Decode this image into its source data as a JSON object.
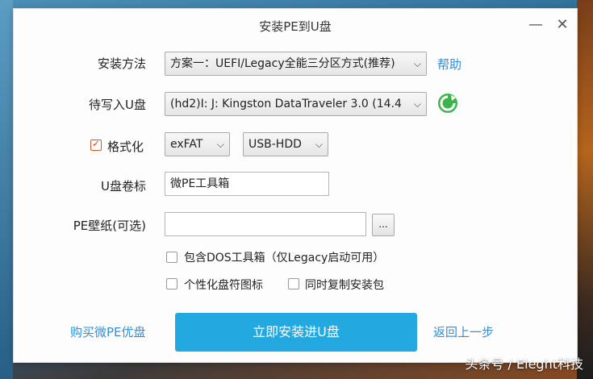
{
  "window": {
    "title": "安装PE到U盘",
    "minimize_glyph": "—",
    "close_glyph": "✕"
  },
  "install_method": {
    "label": "安装方法",
    "selected": "方案一：UEFI/Legacy全能三分区方式(推荐)",
    "help_link": "帮助"
  },
  "target_drive": {
    "label": "待写入U盘",
    "selected": "(hd2)I: J: Kingston DataTraveler 3.0 (14.4"
  },
  "format": {
    "label": "格式化",
    "checked": true,
    "filesystem": "exFAT",
    "mode": "USB-HDD"
  },
  "volume_label": {
    "label": "U盘卷标",
    "value": "微PE工具箱"
  },
  "wallpaper": {
    "label": "PE壁纸(可选)",
    "value": "",
    "browse_label": "..."
  },
  "options": {
    "dos_tools": "包含DOS工具箱（仅Legacy启动可用）",
    "custom_icon": "个性化盘符图标",
    "copy_installer": "同时复制安装包"
  },
  "footer": {
    "buy_link": "购买微PE优盘",
    "install_button": "立即安装进U盘",
    "back_link": "返回上一步"
  },
  "watermark": "头条号 / Eleght科技",
  "colors": {
    "accent": "#23a8e0",
    "link": "#2f8fd8",
    "refresh_green": "#3bb54a"
  }
}
